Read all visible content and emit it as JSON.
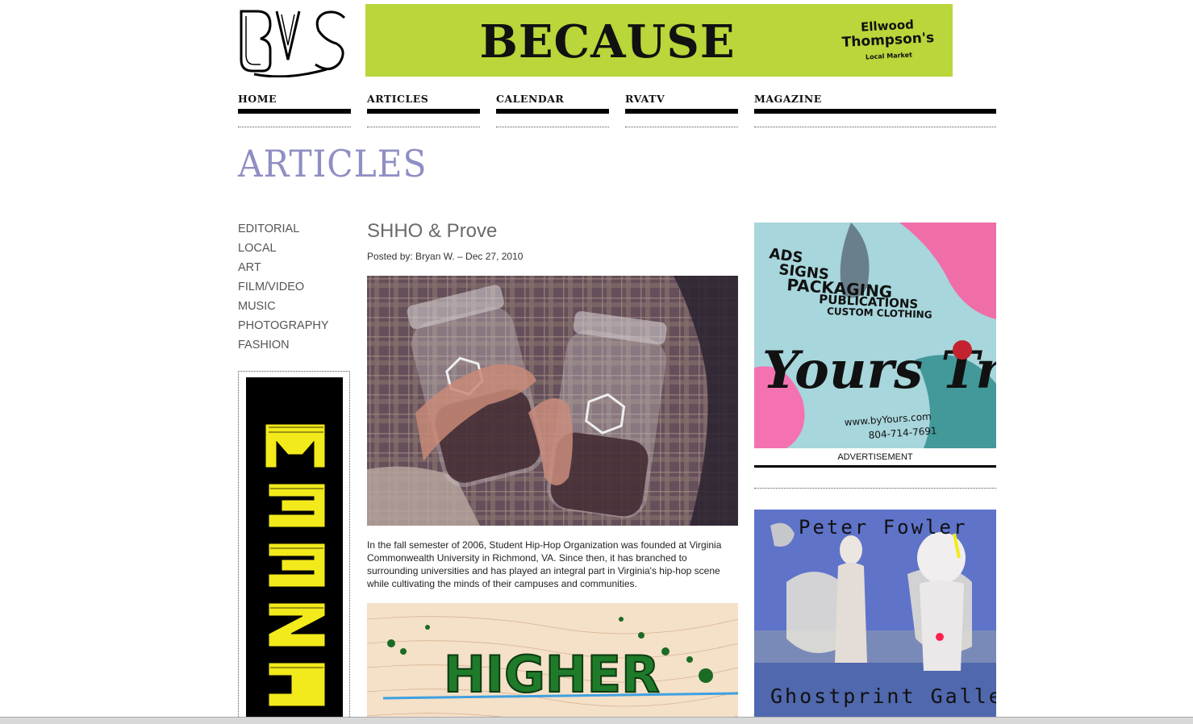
{
  "site": {
    "logo_text": "RVS"
  },
  "banner": {
    "headline": "BECAUSE",
    "brand_line1": "Ellwood",
    "brand_line2": "Thompson's",
    "brand_line3": "Local Market",
    "background_color": "#b9d63a"
  },
  "nav": {
    "items": [
      {
        "label": "HOME"
      },
      {
        "label": "ARTICLES"
      },
      {
        "label": "CALENDAR"
      },
      {
        "label": "RVATV"
      },
      {
        "label": "MAGAZINE"
      }
    ]
  },
  "page": {
    "heading": "ARTICLES",
    "heading_color": "#8f8ec4"
  },
  "categories": [
    "EDITORIAL",
    "LOCAL",
    "ART",
    "FILM/VIDEO",
    "MUSIC",
    "PHOTOGRAPHY",
    "FASHION"
  ],
  "left_ad": {
    "text": "WEEZIE",
    "colors": {
      "background": "#000000",
      "letters": "#f2ea1a"
    }
  },
  "article": {
    "title": "SHHO & Prove",
    "meta": "Posted by: Bryan W. – Dec 27, 2010",
    "body": "In the fall semester of 2006, Student Hip-Hop Organization was founded at Virginia Commonwealth University in Richmond, VA. Since then, it has branched to surrounding universities and has played an integral part in Virginia's hip-hop scene while cultivating the minds of their campuses and communities.",
    "art_text": "HIGHER"
  },
  "right_ads": {
    "ad1": {
      "lines": [
        "ADS",
        "SIGNS",
        "PACKAGING",
        "PUBLICATIONS",
        "CUSTOM CLOTHING"
      ],
      "script_text": "Yours Truly",
      "url": "www.byYours.com",
      "phone": "804-714-7691",
      "caption": "ADVERTISEMENT"
    },
    "ad2": {
      "artist": "Peter Fowler",
      "gallery": "Ghostprint Gallery"
    }
  }
}
